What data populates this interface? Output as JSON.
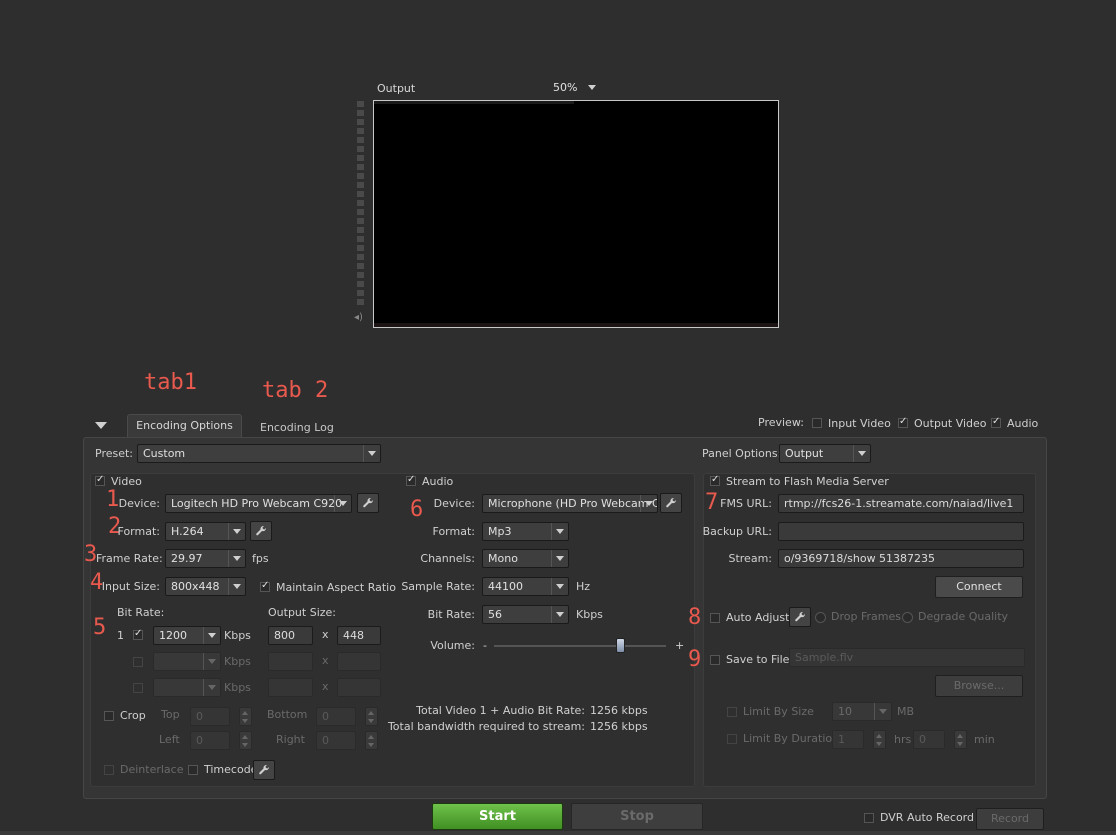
{
  "preview_area": {
    "title": "Output",
    "zoom": "50%"
  },
  "annotations": {
    "tab1": "tab1",
    "tab2": "tab 2",
    "n1": "1",
    "n2": "2",
    "n3": "3",
    "n4": "4",
    "n5": "5",
    "n6": "6",
    "n7": "7",
    "n8": "8",
    "n9": "9"
  },
  "tabs": {
    "encoding_options": "Encoding Options",
    "encoding_log": "Encoding Log"
  },
  "preview_options": {
    "label": "Preview:",
    "input_video": "Input Video",
    "input_video_checked": false,
    "output_video": "Output Video",
    "output_video_checked": true,
    "audio": "Audio",
    "audio_checked": true
  },
  "preset": {
    "label": "Preset:",
    "value": "Custom"
  },
  "panel_options": {
    "label": "Panel Options:",
    "value": "Output"
  },
  "video": {
    "title": "Video",
    "checked": true,
    "device_label": "Device:",
    "device": "Logitech HD Pro Webcam C920",
    "format_label": "Format:",
    "format": "H.264",
    "frame_rate_label": "Frame Rate:",
    "frame_rate": "29.97",
    "fps_unit": "fps",
    "input_size_label": "Input Size:",
    "input_size": "800x448",
    "maintain_aspect": "Maintain Aspect Ratio",
    "maintain_aspect_checked": true,
    "bit_rate_label": "Bit Rate:",
    "output_size_label": "Output Size:",
    "rows": [
      {
        "num": "1",
        "checked": true,
        "bitrate": "1200",
        "unit": "Kbps",
        "width": "800",
        "x": "x",
        "height": "448",
        "enabled": true
      },
      {
        "num": "",
        "checked": false,
        "bitrate": "",
        "unit": "Kbps",
        "width": "",
        "x": "x",
        "height": "",
        "enabled": false
      },
      {
        "num": "",
        "checked": false,
        "bitrate": "",
        "unit": "Kbps",
        "width": "",
        "x": "x",
        "height": "",
        "enabled": false
      }
    ],
    "crop": "Crop",
    "top": "Top",
    "bottom": "Bottom",
    "left": "Left",
    "right": "Right",
    "crop_top": "0",
    "crop_bottom": "0",
    "crop_left": "0",
    "crop_right": "0",
    "deinterlace": "Deinterlace",
    "timecode": "Timecode"
  },
  "audio": {
    "title": "Audio",
    "checked": true,
    "device_label": "Device:",
    "device": "Microphone (HD Pro Webcam C",
    "format_label": "Format:",
    "format": "Mp3",
    "channels_label": "Channels:",
    "channels": "Mono",
    "sample_rate_label": "Sample Rate:",
    "sample_rate": "44100",
    "hz_unit": "Hz",
    "bit_rate_label": "Bit Rate:",
    "bit_rate": "56",
    "kbps_unit": "Kbps",
    "volume_label": "Volume:",
    "minus": "-",
    "plus": "+",
    "volume_level": 0.74,
    "total_label": "Total Video 1 + Audio Bit Rate:",
    "total_value": "1256 kbps",
    "bandwidth_label": "Total bandwidth required to stream:",
    "bandwidth_value": "1256 kbps"
  },
  "stream": {
    "title": "Stream to Flash Media Server",
    "checked": true,
    "fms_label": "FMS URL:",
    "fms_url": "rtmp://fcs26-1.streamate.com/naiad/live1",
    "backup_label": "Backup URL:",
    "backup_url": "",
    "stream_label": "Stream:",
    "stream_value": "o/9369718/show  51387235",
    "connect": "Connect",
    "auto_adjust": "Auto Adjust",
    "drop_frames": "Drop Frames",
    "degrade_quality": "Degrade Quality",
    "save_to_file": "Save to File",
    "file_placeholder": "Sample.flv",
    "browse": "Browse...",
    "limit_size": "Limit By Size",
    "limit_size_value": "10",
    "mb": "MB",
    "limit_duration": "Limit By Duration",
    "hrs_value": "1",
    "hrs": "hrs",
    "min": "min",
    "min_value": "0"
  },
  "bottom": {
    "start": "Start",
    "stop": "Stop",
    "dvr": "DVR Auto Record",
    "record": "Record"
  }
}
